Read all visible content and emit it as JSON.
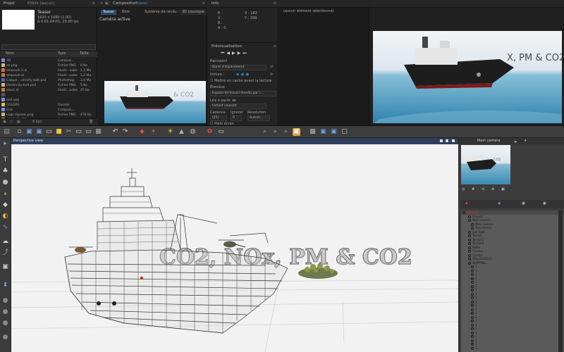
{
  "ae": {
    "project": {
      "tabs": [
        "Projet",
        "Effets  (aucun)"
      ],
      "comp_name": "Teaser",
      "comp_info": [
        "1920 x 1080 (1,00)",
        "Δ 0:01:04:01, 25,00 ips"
      ],
      "columns": [
        "Nom",
        "Type",
        "Taille"
      ],
      "items": [
        {
          "name": "3D",
          "type": "Composi...",
          "size": "",
          "color": "#8a8ad6"
        },
        {
          "name": "air.png",
          "type": "Fichier PNG",
          "size": "6 Ko",
          "color": "#c9b98a"
        },
        {
          "name": "ampoule 2.ai",
          "type": "Illustr...uobe",
          "size": "1,2 Mo",
          "color": "#c97a34"
        },
        {
          "name": "ampoule.ai",
          "type": "Illustr...uobe",
          "size": "1,2 Mo",
          "color": "#c97a34"
        },
        {
          "name": "Calque ...ctricity-bolt.psd",
          "type": "Photoshop",
          "size": "3,4 Mo",
          "color": "#3a6fb0"
        },
        {
          "name": "Electricity-bolt.psd",
          "type": "Fichier PNG",
          "size": "5 Ko",
          "color": "#c9b98a"
        },
        {
          "name": "eloce.ai",
          "type": "Illustr...uobe",
          "size": "45 Ko",
          "color": "#c97a34"
        },
        {
          "name": "",
          "type": "",
          "size": "",
          "color": "#555"
        },
        {
          "name": "end.aep",
          "type": "",
          "size": "",
          "color": "#8a8ad6"
        },
        {
          "name": "COLORS",
          "type": "Dossier",
          "size": "",
          "color": "#d6c14a"
        },
        {
          "name": "End",
          "type": "Composi...",
          "size": "",
          "color": "#8a8ad6"
        },
        {
          "name": "Logo Hyseas.png",
          "type": "Fichier PNG",
          "size": "476 Ko",
          "color": "#c9b98a"
        },
        {
          "name": "LOGO PAGES",
          "type": "Dossier",
          "size": "",
          "color": "#d6c14a"
        }
      ],
      "bottom_info": "8 bpc"
    },
    "composition": {
      "tab": "Composition",
      "tab_name": "Teaser",
      "subtabs": [
        "Teaser",
        "Blue",
        "Système de rendu :",
        "3D classique"
      ],
      "camera": "Caméra active"
    },
    "info": {
      "tab": "Info",
      "rgb": [
        "R :",
        "V :",
        "B :",
        "A : 0"
      ],
      "coords": [
        "X : 182",
        "Y : 299"
      ],
      "preview_title": "Prévisualisation",
      "shortcut_label": "Raccourci",
      "shortcut_value": "Barre d'espacement",
      "include_label": "Inclure :",
      "cache_label": "Mettre en cache avant la lecture",
      "range_label": "Étendue",
      "range_value": "Espace de travail étendu par l...",
      "play_from_label": "Lire à partir de",
      "play_from_value": "Instant courant",
      "cadence_label": "Cadence",
      "skip_label": "Ignorer",
      "resolution_label": "Résolution",
      "cadence_value": "(25)",
      "skip_value": "0",
      "resolution_value": "Autom...",
      "fullscreen_label": "Plein écran"
    },
    "middle": {
      "text": "(aucun élément sélectionné)"
    }
  },
  "persp": {
    "header": "Perspective view",
    "title_text": "CO2, NOx, PM & CO2"
  },
  "right": {
    "camera_label": "Main camera",
    "outliner": [
      {
        "label": "Layer 1",
        "indent": 0,
        "red": true
      },
      {
        "label": "Ground",
        "indent": 2,
        "red": false
      },
      {
        "label": "Main camera",
        "indent": 2,
        "red": false
      },
      {
        "label": "Main camera",
        "indent": 3,
        "red": false
      },
      {
        "label": "Top camera",
        "indent": 3,
        "red": false
      },
      {
        "label": "Sun light",
        "indent": 2,
        "red": false
      },
      {
        "label": "Terrain",
        "indent": 2,
        "red": false
      },
      {
        "label": "Terrain2",
        "indent": 2,
        "red": false
      },
      {
        "label": "Terrain3",
        "indent": 2,
        "red": false
      },
      {
        "label": "Water",
        "indent": 2,
        "red": false
      },
      {
        "label": "Corsica",
        "indent": 2,
        "red": false
      },
      {
        "label": "Corsila",
        "indent": 2,
        "red": false
      },
      {
        "label": "Ship.R100511",
        "indent": 2,
        "red": false
      },
      {
        "label": "SHIPPING",
        "indent": 2,
        "red": false
      },
      {
        "label": "1",
        "indent": 3,
        "red": false
      },
      {
        "label": "1",
        "indent": 3,
        "red": false
      },
      {
        "label": "1",
        "indent": 3,
        "red": false
      },
      {
        "label": "1",
        "indent": 3,
        "red": false
      },
      {
        "label": "1",
        "indent": 3,
        "red": false
      },
      {
        "label": "1",
        "indent": 3,
        "red": false
      },
      {
        "label": "1",
        "indent": 3,
        "red": false
      },
      {
        "label": "1",
        "indent": 3,
        "red": false
      },
      {
        "label": "1",
        "indent": 3,
        "red": false
      },
      {
        "label": "1",
        "indent": 3,
        "red": false
      },
      {
        "label": "1",
        "indent": 3,
        "red": false
      },
      {
        "label": "1",
        "indent": 3,
        "red": false
      },
      {
        "label": "1",
        "indent": 3,
        "red": false
      },
      {
        "label": "1",
        "indent": 3,
        "red": false
      },
      {
        "label": "1",
        "indent": 3,
        "red": false
      },
      {
        "label": "1",
        "indent": 3,
        "red": false
      },
      {
        "label": "1",
        "indent": 3,
        "red": false
      },
      {
        "label": "1",
        "indent": 3,
        "red": false
      },
      {
        "label": "1",
        "indent": 3,
        "red": false
      },
      {
        "label": "1",
        "indent": 3,
        "red": false
      },
      {
        "label": "1",
        "indent": 3,
        "red": false
      },
      {
        "label": "1",
        "indent": 3,
        "red": false
      }
    ]
  },
  "colors": {
    "accent_blue": "#2e3f5c",
    "ae_blue_text": "#3d8fd6",
    "selection_red": "#d93030"
  }
}
